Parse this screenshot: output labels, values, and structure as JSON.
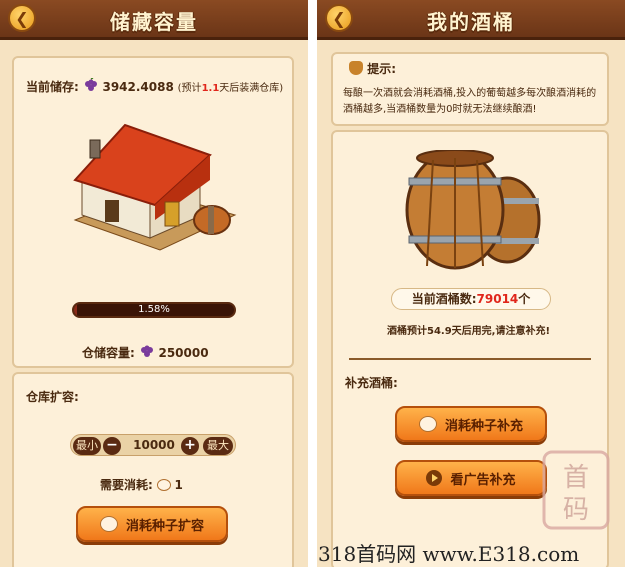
{
  "left": {
    "back_icon": "back-arrow-icon",
    "title": "储藏容量",
    "storage_label": "当前储存:",
    "storage_value": "3942.4088",
    "storage_note_pre": "(预计",
    "storage_note_days": "1.1",
    "storage_note_post": "天后装满仓库)",
    "progress_text": "1.58%",
    "progress_fraction": 0.0158,
    "capacity_label": "仓储容量:",
    "capacity_value": "250000",
    "expand_label": "仓库扩容:",
    "stepper": {
      "min_label": "最小",
      "minus": "−",
      "value": "10000",
      "plus": "+",
      "max_label": "最大"
    },
    "cost_label": "需要消耗:",
    "cost_value": "1",
    "expand_button": "消耗种子扩容"
  },
  "right": {
    "back_icon": "back-arrow-icon",
    "title": "我的酒桶",
    "tip_title": "提示:",
    "tip_line1": "每酿一次酒就会消耗酒桶,投入的葡萄越多每次酿酒消耗的",
    "tip_line2": "酒桶越多,当酒桶数量为0时就无法继续酿酒!",
    "barrel_label": "当前酒桶数:",
    "barrel_value": "79014",
    "barrel_unit": "个",
    "barrel_note": "酒桶预计54.9天后用完,请注意补充!",
    "refill_label": "补充酒桶:",
    "seed_button": "消耗种子补充",
    "ad_button": "看广告补充"
  },
  "watermark": "318首码网 www.E318.com",
  "colors": {
    "accent": "#f0781a",
    "title_bar": "#6b3517",
    "panel": "#fdf0d9",
    "red_text": "#e0261b"
  }
}
